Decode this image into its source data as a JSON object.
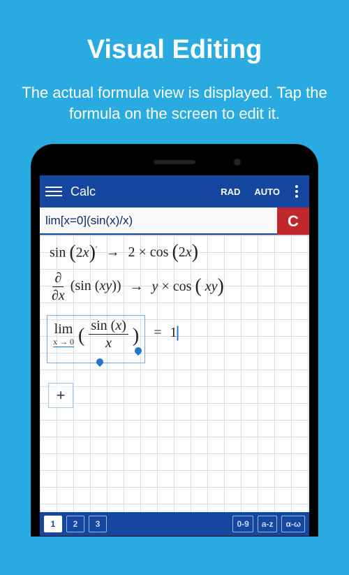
{
  "hero": {
    "title": "Visual Editing",
    "subtitle": "The actual formula view is displayed. Tap the formula on the screen to edit it."
  },
  "appbar": {
    "title": "Calc",
    "angle_mode": "RAD",
    "precision_mode": "AUTO"
  },
  "input": {
    "value": "lim[x=0](sin(x)/x)",
    "clear_label": "C"
  },
  "rows": [
    {
      "expr_html": "sin <span class='paren'>(</span>2<span class='italic'>x</span><span class='paren'>)</span><span class='sup'>′</span>",
      "result_html": "2 × cos <span class='paren'>(</span>2<span class='italic'>x</span><span class='paren'>)</span>"
    },
    {
      "expr_html": "<span class='frac'><span class='num'>∂</span><span class='den'>∂<span class=italic>x</span></span></span> (sin (<span class='italic'>xy</span>))",
      "result_html": "<span class='italic'>y</span> × cos <span class='paren'>(</span> <span class='italic'>xy</span><span class='paren'>)</span>"
    }
  ],
  "active_row": {
    "lim_label": "lim",
    "lim_sub": "x → 0",
    "arg_num": "sin (<span class='italic'>x</span>)",
    "arg_den": "<span class='italic'>x</span>",
    "equals": "=",
    "result": "1"
  },
  "add_label": "+",
  "arrow": "→",
  "tabs": {
    "pages": [
      "1",
      "2",
      "3"
    ],
    "modes": [
      "0-9",
      "a-z",
      "α-ω"
    ],
    "active_page": "1"
  }
}
